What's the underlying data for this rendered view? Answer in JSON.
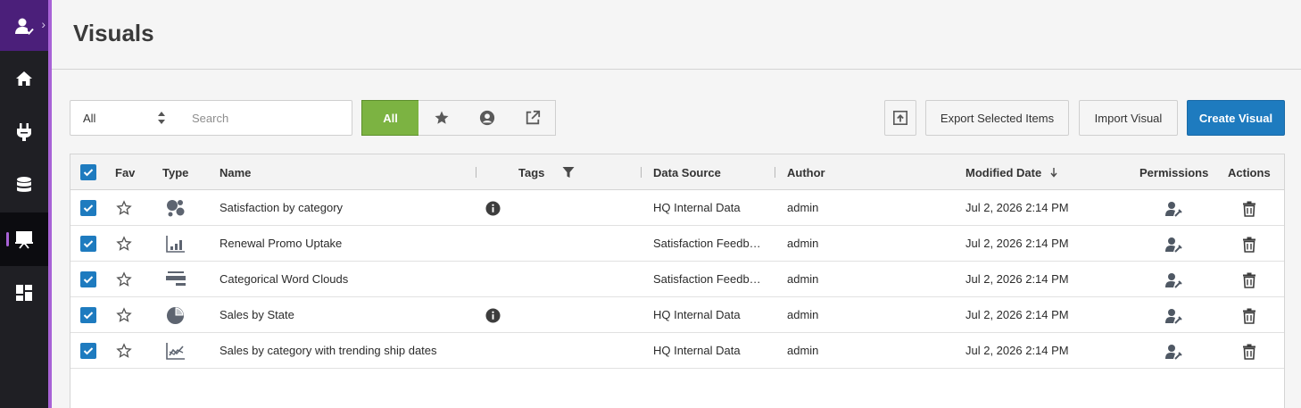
{
  "header": {
    "title": "Visuals"
  },
  "sidebar": {
    "items": [
      {
        "name": "user-menu",
        "icon": "user-check-icon"
      },
      {
        "name": "home",
        "icon": "home-icon"
      },
      {
        "name": "connections",
        "icon": "plug-icon"
      },
      {
        "name": "data",
        "icon": "database-icon"
      },
      {
        "name": "visuals",
        "icon": "presentation-icon",
        "active": true
      },
      {
        "name": "dashboards",
        "icon": "dashboard-icon"
      }
    ]
  },
  "toolbar": {
    "filter_value": "All",
    "search_placeholder": "Search",
    "segments": {
      "all_label": "All"
    },
    "export_label": "Export Selected Items",
    "import_label": "Import Visual",
    "create_label": "Create Visual"
  },
  "table": {
    "columns": {
      "fav": "Fav",
      "type": "Type",
      "name": "Name",
      "tags": "Tags",
      "data_source": "Data Source",
      "author": "Author",
      "modified": "Modified Date",
      "permissions": "Permissions",
      "actions": "Actions"
    },
    "rows": [
      {
        "name": "Satisfaction by category",
        "type_icon": "bubble-chart-icon",
        "info": true,
        "data_source": "HQ Internal Data",
        "author": "admin",
        "modified": "Jul 2, 2026 2:14 PM"
      },
      {
        "name": "Renewal Promo Uptake",
        "type_icon": "bar-chart-icon",
        "info": false,
        "data_source": "Satisfaction Feedb…",
        "author": "admin",
        "modified": "Jul 2, 2026 2:14 PM"
      },
      {
        "name": "Categorical Word Clouds",
        "type_icon": "word-cloud-icon",
        "info": false,
        "data_source": "Satisfaction Feedb…",
        "author": "admin",
        "modified": "Jul 2, 2026 2:14 PM"
      },
      {
        "name": "Sales by State",
        "type_icon": "pie-chart-icon",
        "info": true,
        "data_source": "HQ Internal Data",
        "author": "admin",
        "modified": "Jul 2, 2026 2:14 PM"
      },
      {
        "name": "Sales by category with trending ship dates",
        "type_icon": "line-chart-icon",
        "info": false,
        "data_source": "HQ Internal Data",
        "author": "admin",
        "modified": "Jul 2, 2026 2:14 PM"
      }
    ]
  },
  "colors": {
    "accent_green": "#7cb342",
    "primary_blue": "#1e7bbf",
    "sidebar_purple": "#4b1f7a"
  }
}
